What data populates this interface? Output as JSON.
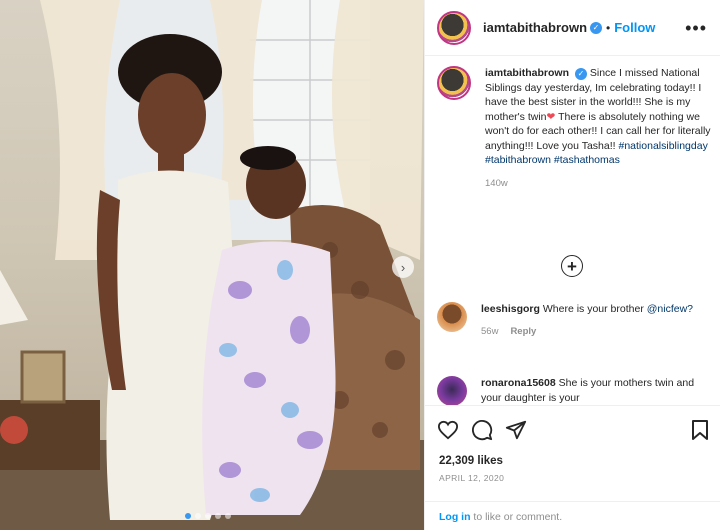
{
  "post": {
    "username": "iamtabithabrown",
    "follow_label": "Follow",
    "separator": "•",
    "more_label": "•••",
    "verified_icon": "verified-badge-icon"
  },
  "caption": {
    "username": "iamtabithabrown",
    "text": "Since I missed National Siblings day yesterday, Im celebrating today!! I have the best sister in the world!!! She is my mother's twin",
    "heart": "❤",
    "text2": "There is absolutely nothing we won't do for each other!! I can call her for literally anything!!! Love you Tasha!!",
    "hashtags": "#nationalsiblingday #tabithabrown #tashathomas",
    "time": "140w"
  },
  "load_more_icon": "+",
  "comments": [
    {
      "username": "leeshisgorg",
      "text": "Where is your brother",
      "mention": "@nicfew?",
      "time": "56w",
      "reply": "Reply"
    },
    {
      "username": "ronarona15608",
      "text": "She is your mothers twin and your daughter is your"
    }
  ],
  "actions": {
    "likes": "22,309 likes",
    "date": "APRIL 12, 2020"
  },
  "login": {
    "link": "Log in",
    "text": "to like or comment."
  },
  "colors": {
    "accent": "#0095f6",
    "heart": "#ed4956",
    "muted": "#8e8e8e"
  },
  "carousel": {
    "slide_count": 5,
    "active_index": 0
  }
}
